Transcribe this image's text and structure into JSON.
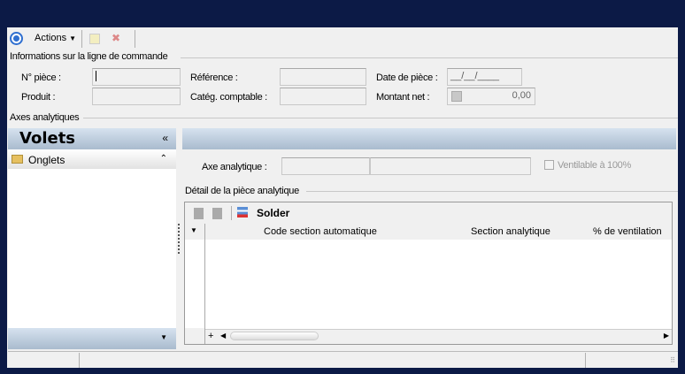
{
  "toolbar": {
    "actions_label": "Actions"
  },
  "section_info": {
    "title": "Informations sur la ligne de commande",
    "num_piece_label": "N° pièce :",
    "num_piece_value": "",
    "produit_label": "Produit :",
    "produit_value": "",
    "reference_label": "Référence :",
    "reference_value": "",
    "categ_label": "Catég. comptable :",
    "categ_value": "",
    "date_label": "Date de pièce :",
    "date_value": "__/__/____",
    "montant_label": "Montant net :",
    "montant_value": "0,00"
  },
  "section_axes": {
    "title": "Axes analytiques"
  },
  "volets": {
    "title": "Volets",
    "items": [
      {
        "label": "Onglets"
      }
    ]
  },
  "axe": {
    "label": "Axe analytique :",
    "code": "",
    "name": "",
    "ventilable_label": "Ventilable à 100%",
    "ventilable_checked": false
  },
  "detail": {
    "title": "Détail de la pièce analytique",
    "solder_label": "Solder",
    "columns": [
      "Code section automatique",
      "Section analytique",
      "% de ventilation"
    ],
    "rows": []
  }
}
